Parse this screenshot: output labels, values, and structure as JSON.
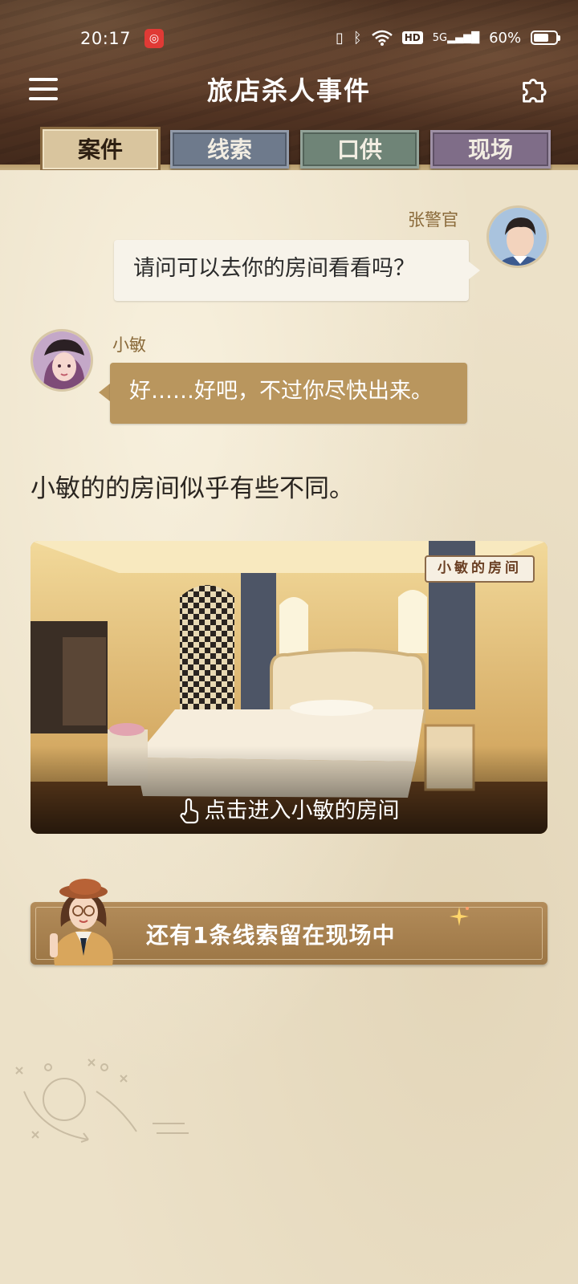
{
  "status_bar": {
    "time": "20:17",
    "app_badge_icon": "netease-music-icon",
    "hd_label": "HD",
    "network": "5G",
    "battery": "60%"
  },
  "header": {
    "title": "旅店杀人事件",
    "menu_icon": "hamburger-menu-icon",
    "settings_icon": "puzzle-icon"
  },
  "tabs": [
    {
      "label": "案件",
      "active": true
    },
    {
      "label": "线索",
      "active": false
    },
    {
      "label": "口供",
      "active": false
    },
    {
      "label": "现场",
      "active": false
    }
  ],
  "messages": [
    {
      "speaker": "张警官",
      "text": "请问可以去你的房间看看吗？",
      "side": "right"
    },
    {
      "speaker": "小敏",
      "text": "好……好吧，不过你尽快出来。",
      "side": "left"
    }
  ],
  "narration": "小敏的的房间似乎有些不同。",
  "room_card": {
    "badge": "小敏的房间",
    "cta": "点击进入小敏的房间"
  },
  "hint": {
    "text": "还有1条线索留在现场中"
  },
  "colors": {
    "header_wood": "#4a2f1f",
    "paper": "#ece1c8",
    "bubble_dark": "#b9965e",
    "bubble_light": "#f7f3ea",
    "speaker_name": "#8a6a3a"
  }
}
